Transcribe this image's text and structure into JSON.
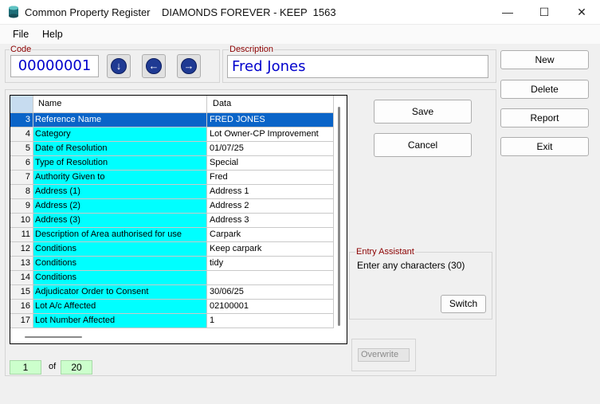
{
  "window": {
    "title": "Common Property Register    DIAMONDS FOREVER - KEEP  1563",
    "minimize_glyph": "—",
    "maximize_glyph": "☐",
    "close_glyph": "✕"
  },
  "menu": {
    "items": [
      "File",
      "Help"
    ]
  },
  "code": {
    "label": "Code",
    "value": "00000001"
  },
  "description": {
    "label": "Description",
    "value": "Fred Jones"
  },
  "nav_icons": [
    "arrow-down-icon",
    "arrow-left-icon",
    "arrow-right-icon"
  ],
  "nav_glyphs": {
    "down": "↓",
    "left": "←",
    "right": "→"
  },
  "side_buttons": {
    "new": "New",
    "delete": "Delete",
    "report": "Report",
    "exit": "Exit"
  },
  "form_buttons": {
    "save": "Save",
    "cancel": "Cancel"
  },
  "grid": {
    "headers": {
      "name": "Name",
      "data": "Data"
    },
    "rows": [
      {
        "num": "3",
        "name": "Reference Name",
        "data": "FRED JONES"
      },
      {
        "num": "4",
        "name": "Category",
        "data": "Lot Owner-CP Improvement"
      },
      {
        "num": "5",
        "name": "Date of Resolution",
        "data": "01/07/25"
      },
      {
        "num": "6",
        "name": "Type of Resolution",
        "data": "Special"
      },
      {
        "num": "7",
        "name": "Authority Given to",
        "data": "Fred"
      },
      {
        "num": "8",
        "name": "Address (1)",
        "data": "Address 1"
      },
      {
        "num": "9",
        "name": "Address (2)",
        "data": "Address 2"
      },
      {
        "num": "10",
        "name": "Address (3)",
        "data": "Address 3"
      },
      {
        "num": "11",
        "name": "Description of Area authorised for use",
        "data": "Carpark"
      },
      {
        "num": "12",
        "name": "Conditions",
        "data": "Keep carpark"
      },
      {
        "num": "13",
        "name": "Conditions",
        "data": "tidy"
      },
      {
        "num": "14",
        "name": "Conditions",
        "data": ""
      },
      {
        "num": "15",
        "name": "Adjudicator Order to Consent",
        "data": "30/06/25"
      },
      {
        "num": "16",
        "name": "Lot A/c Affected",
        "data": "02100001"
      },
      {
        "num": "17",
        "name": "Lot Number Affected",
        "data": "1"
      }
    ]
  },
  "entry_assistant": {
    "label": "Entry Assistant",
    "text": "Enter any characters (30)",
    "switch": "Switch"
  },
  "overwrite": {
    "label": "Overwrite"
  },
  "counter": {
    "current": "1",
    "of": "of",
    "total": "20"
  },
  "colors": {
    "selected_row": "#0a64c8",
    "name_cell": "#00ffff",
    "code_text": "#0000cc",
    "group_label": "#8b0000",
    "counter_bg": "#ccffcc"
  }
}
